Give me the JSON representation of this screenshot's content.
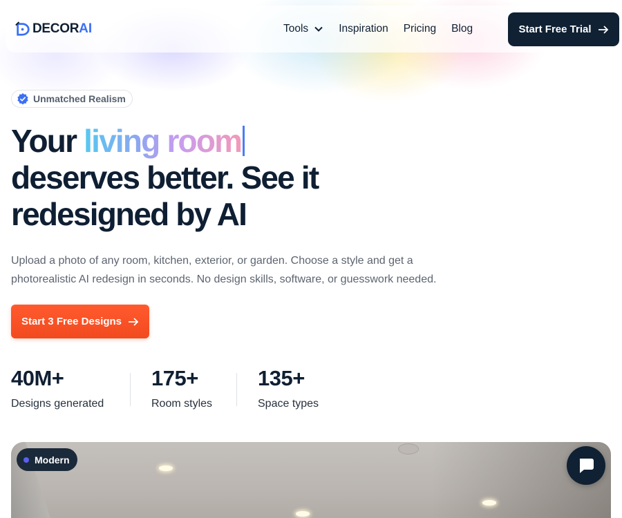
{
  "nav": {
    "logo_text": "DECOR",
    "logo_accent": "AI",
    "links": [
      "Tools",
      "Inspiration",
      "Pricing",
      "Blog"
    ],
    "cta": "Start Free Trial"
  },
  "hero": {
    "badge": "Unmatched Realism",
    "headline_start": "Your ",
    "headline_highlight": "living room",
    "headline_line2": "deserves better. See it",
    "headline_line3": "redesigned by AI",
    "subtext": "Upload a photo of any room, kitchen, exterior, or garden. Choose a style and get a photorealistic AI redesign in seconds. No design skills, software, or guesswork needed.",
    "cta": "Start 3 Free Designs"
  },
  "stats": [
    {
      "value": "40M+",
      "label": "Designs generated"
    },
    {
      "value": "175+",
      "label": "Room styles"
    },
    {
      "value": "135+",
      "label": "Space types"
    }
  ],
  "preview": {
    "style_tag": "Modern"
  },
  "icons": {
    "logo": "decor-logo-icon",
    "tools_chevron": "chevron-down-icon",
    "cta_arrow": "arrow-right-icon",
    "badge": "verified-badge-icon",
    "chat": "chat-bubble-icon"
  },
  "colors": {
    "navy": "#0f2133",
    "accent_blue": "#3b6ff5",
    "cta_orange": "#f24a1f",
    "tag_dot": "#5b5ff0"
  }
}
